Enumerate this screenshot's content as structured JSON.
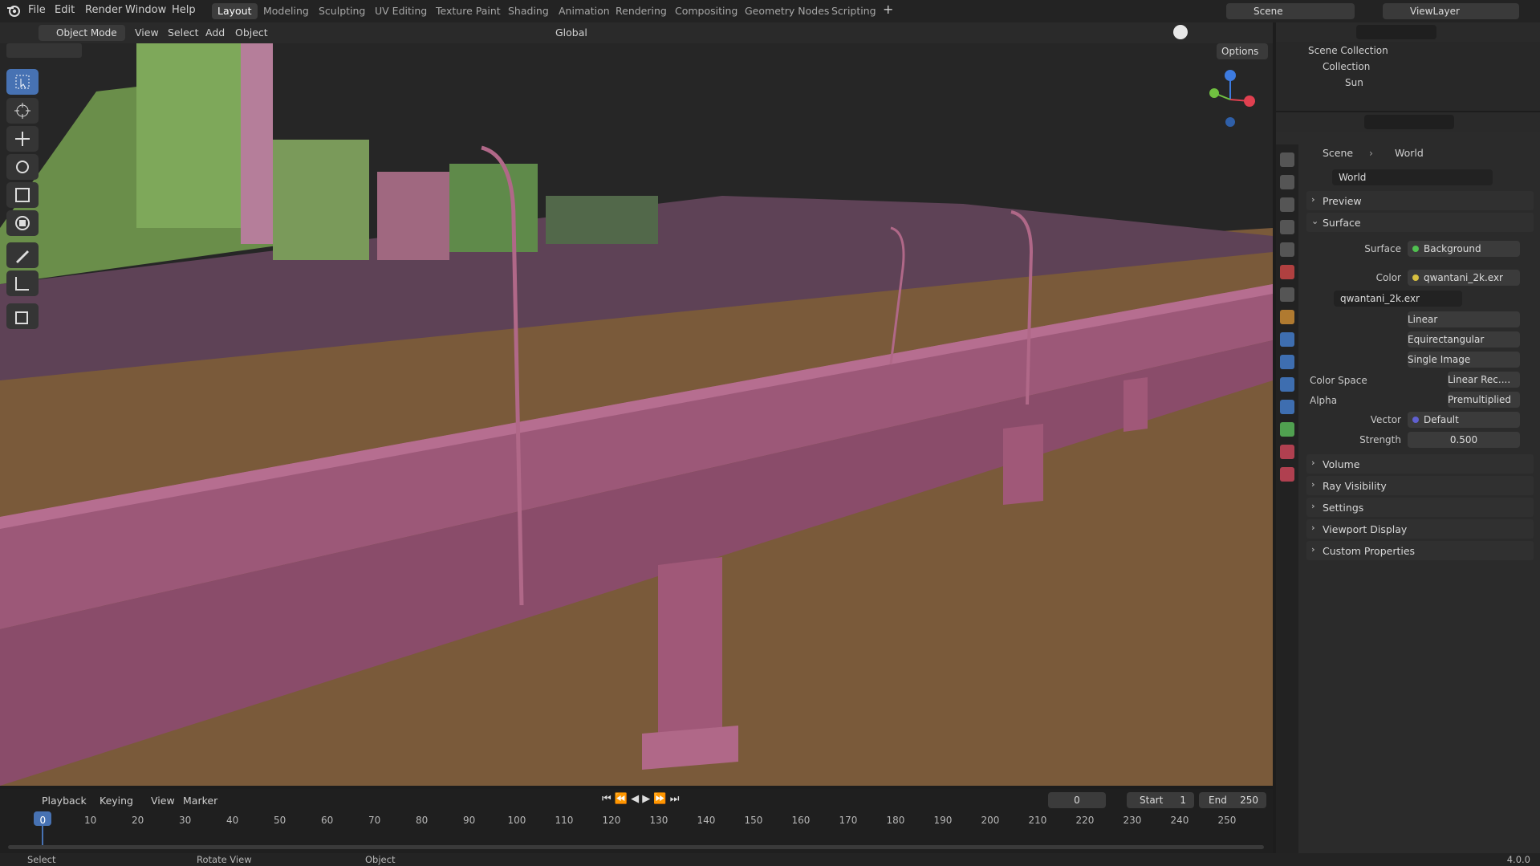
{
  "app": {
    "version": "4.0.0"
  },
  "menu": [
    "File",
    "Edit",
    "Render",
    "Window",
    "Help"
  ],
  "workspaces": [
    "Layout",
    "Modeling",
    "Sculpting",
    "UV Editing",
    "Texture Paint",
    "Shading",
    "Animation",
    "Rendering",
    "Compositing",
    "Geometry Nodes",
    "Scripting"
  ],
  "active_workspace": "Layout",
  "scene_name": "Scene",
  "view_layer": "ViewLayer",
  "viewport_header": {
    "mode": "Object Mode",
    "menus": [
      "View",
      "Select",
      "Add",
      "Object"
    ],
    "orientation": "Global",
    "options": "Options"
  },
  "outliner": {
    "root": "Scene Collection",
    "collection": "Collection",
    "child": "Sun"
  },
  "properties": {
    "breadcrumb_scene": "Scene",
    "breadcrumb_world": "World",
    "world_name": "World",
    "panels_top": [
      "Preview",
      "Surface"
    ],
    "surface_label": "Surface",
    "surface_value": "Background",
    "color_label": "Color",
    "color_value": "qwantani_2k.exr",
    "image_name": "qwantani_2k.exr",
    "interpolation": "Linear",
    "projection": "Equirectangular",
    "source": "Single Image",
    "color_space_label": "Color Space",
    "color_space": "Linear Rec....",
    "alpha_label": "Alpha",
    "alpha": "Premultiplied",
    "vector_label": "Vector",
    "vector": "Default",
    "strength_label": "Strength",
    "strength": "0.500",
    "panels_bottom": [
      "Volume",
      "Ray Visibility",
      "Settings",
      "Viewport Display",
      "Custom Properties"
    ]
  },
  "timeline": {
    "menus": [
      "Playback",
      "Keying",
      "View",
      "Marker"
    ],
    "current_frame": "0",
    "start_label": "Start",
    "start": "1",
    "end_label": "End",
    "end": "250",
    "ticks": [
      "0",
      "10",
      "20",
      "30",
      "40",
      "50",
      "60",
      "70",
      "80",
      "90",
      "100",
      "110",
      "120",
      "130",
      "140",
      "150",
      "160",
      "170",
      "180",
      "190",
      "200",
      "210",
      "220",
      "230",
      "240",
      "250"
    ]
  },
  "status": {
    "select": "Select",
    "rotate": "Rotate View",
    "object": "Object"
  },
  "colors": {
    "accent": "#4772b3",
    "bridge": "#a05878",
    "ground": "#7a5a3a",
    "active_tab": "#3d3d3d"
  }
}
